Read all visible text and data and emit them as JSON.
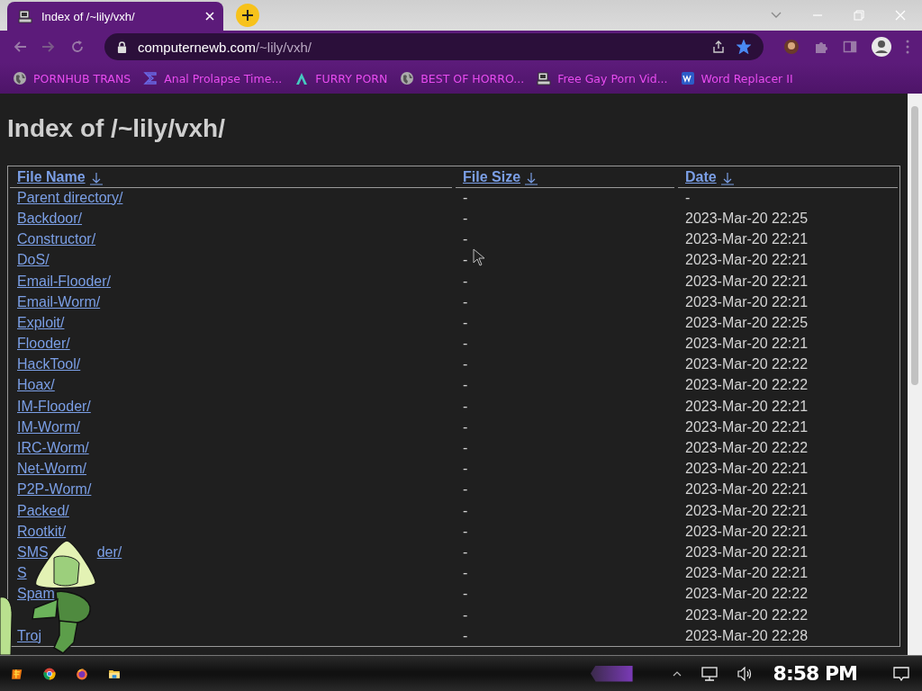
{
  "tab": {
    "title": "Index of /~lily/vxh/",
    "selected": true
  },
  "address_bar": {
    "domain": "computernewb.com",
    "path": "/~lily/vxh/",
    "starred": true
  },
  "bookmarks": [
    {
      "label": "PORNHUB TRANS",
      "kind": "globe"
    },
    {
      "label": "Anal Prolapse Time...",
      "kind": "bracket"
    },
    {
      "label": "FURRY PORN",
      "kind": "lambda"
    },
    {
      "label": "BEST OF HORRO...",
      "kind": "globe"
    },
    {
      "label": "Free Gay Porn Vid...",
      "kind": "computer"
    },
    {
      "label": "Word Replacer II",
      "kind": "wr"
    }
  ],
  "page": {
    "title": "Index of /~lily/vxh/",
    "columns": [
      "File Name",
      "File Size",
      "Date"
    ],
    "rows": [
      {
        "name": "Parent directory/",
        "size": "-",
        "date": "-"
      },
      {
        "name": "Backdoor/",
        "size": "-",
        "date": "2023-Mar-20 22:25"
      },
      {
        "name": "Constructor/",
        "size": "-",
        "date": "2023-Mar-20 22:21"
      },
      {
        "name": "DoS/",
        "size": "-",
        "date": "2023-Mar-20 22:21"
      },
      {
        "name": "Email-Flooder/",
        "size": "-",
        "date": "2023-Mar-20 22:21"
      },
      {
        "name": "Email-Worm/",
        "size": "-",
        "date": "2023-Mar-20 22:21"
      },
      {
        "name": "Exploit/",
        "size": "-",
        "date": "2023-Mar-20 22:25"
      },
      {
        "name": "Flooder/",
        "size": "-",
        "date": "2023-Mar-20 22:21"
      },
      {
        "name": "HackTool/",
        "size": "-",
        "date": "2023-Mar-20 22:22"
      },
      {
        "name": "Hoax/",
        "size": "-",
        "date": "2023-Mar-20 22:22"
      },
      {
        "name": "IM-Flooder/",
        "size": "-",
        "date": "2023-Mar-20 22:21"
      },
      {
        "name": "IM-Worm/",
        "size": "-",
        "date": "2023-Mar-20 22:21"
      },
      {
        "name": "IRC-Worm/",
        "size": "-",
        "date": "2023-Mar-20 22:22"
      },
      {
        "name": "Net-Worm/",
        "size": "-",
        "date": "2023-Mar-20 22:21"
      },
      {
        "name": "P2P-Worm/",
        "size": "-",
        "date": "2023-Mar-20 22:21"
      },
      {
        "name": "Packed/",
        "size": "-",
        "date": "2023-Mar-20 22:21"
      },
      {
        "name": "Rootkit/",
        "size": "-",
        "date": "2023-Mar-20 22:21"
      },
      {
        "name": "SMS",
        "name_tail": "der/",
        "size": "-",
        "date": "2023-Mar-20 22:21"
      },
      {
        "name": "S",
        "size": "-",
        "date": "2023-Mar-20 22:21"
      },
      {
        "name": "Spam",
        "size": "-",
        "date": "2023-Mar-20 22:22"
      },
      {
        "size": "-",
        "date": "2023-Mar-20 22:22"
      },
      {
        "name": "Troj",
        "size": "-",
        "date": "2023-Mar-20 22:28"
      }
    ]
  },
  "taskbar": {
    "clock": "8:58 PM"
  }
}
